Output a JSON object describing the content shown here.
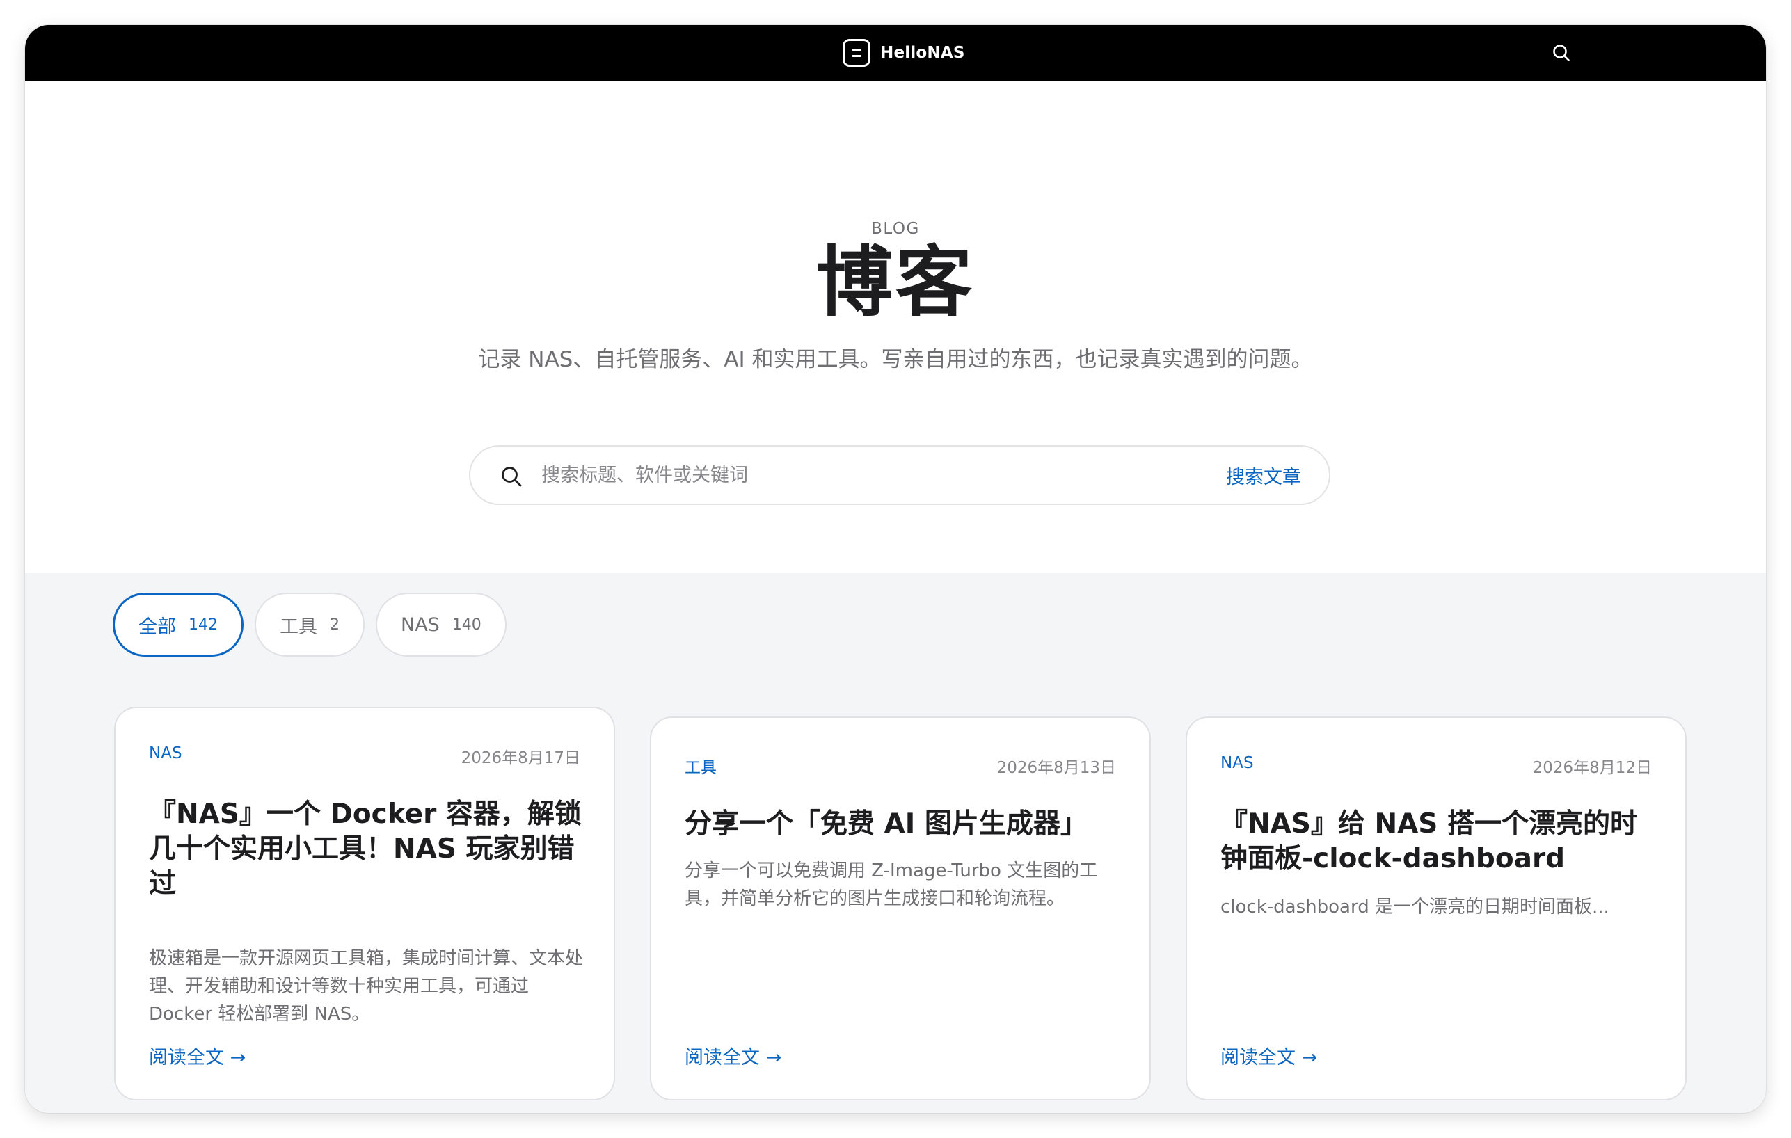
{
  "nav": {
    "brand": "HelloNAS",
    "logo_icon": "document-lines-icon",
    "search_icon": "search-icon"
  },
  "hero": {
    "eyebrow": "BLOG",
    "title": "博客",
    "subtitle": "记录 NAS、自托管服务、AI 和实用工具。写亲自用过的东西，也记录真实遇到的问题。"
  },
  "search": {
    "placeholder": "搜索标题、软件或关键词",
    "value": "",
    "button": "搜索文章"
  },
  "filters": [
    {
      "label": "全部",
      "count": "142",
      "active": true
    },
    {
      "label": "工具",
      "count": "2",
      "active": false
    },
    {
      "label": "NAS",
      "count": "140",
      "active": false
    }
  ],
  "posts": [
    {
      "tag": "NAS",
      "date": "2026年8月17日",
      "title": "『NAS』一个 Docker 容器，解锁几十个实用小工具！NAS 玩家别错过",
      "excerpt": "极速箱是一款开源网页工具箱，集成时间计算、文本处理、开发辅助和设计等数十种实用工具，可通过 Docker 轻松部署到 NAS。",
      "more": "阅读全文 →"
    },
    {
      "tag": "工具",
      "date": "2026年8月13日",
      "title": "分享一个「免费 AI 图片生成器」",
      "excerpt": "分享一个可以免费调用 Z-Image-Turbo 文生图的工具，并简单分析它的图片生成接口和轮询流程。",
      "more": "阅读全文 →"
    },
    {
      "tag": "NAS",
      "date": "2026年8月12日",
      "title": "『NAS』给 NAS 搭一个漂亮的时钟面板-clock-dashboard",
      "excerpt": "clock-dashboard 是一个漂亮的日期时间面板...",
      "more": "阅读全文 →"
    }
  ],
  "colors": {
    "accent": "#0a66c2",
    "nav_bg": "#000000",
    "page_bg": "#f4f5f7",
    "text_primary": "#1d1d1f",
    "text_secondary": "#6e6e73"
  }
}
